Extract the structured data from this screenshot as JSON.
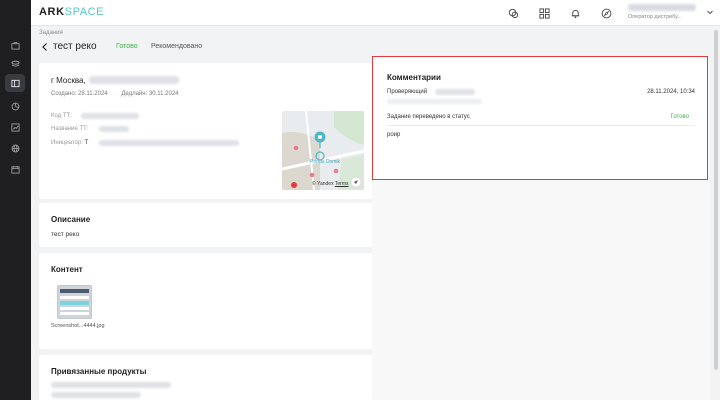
{
  "app": {
    "logo_main": "ARK",
    "logo_accent": "SPACE"
  },
  "user": {
    "role": "Оператор дистрибу..."
  },
  "breadcrumb": "Задания",
  "task": {
    "title": "тест реко",
    "status": "Готово",
    "recommended": "Рекомендовано"
  },
  "info": {
    "address": "г Москва,",
    "created": "Создано: 28.11.2024",
    "deadline": "Дедлайн: 30.11.2024",
    "field_code": "Код ТТ:",
    "field_name": "Название ТТ:",
    "field_initiator": "Инициатор:",
    "initiator_prefix": "Т",
    "map_place": "Portas Domik",
    "map_attribution": "© Yandex",
    "map_terms": "Terms"
  },
  "description": {
    "title": "Описание",
    "text": "тест реко"
  },
  "content": {
    "title": "Контент",
    "file_name": "Screenshot...4444.jpg"
  },
  "products": {
    "title": "Привязанные продукты"
  },
  "comments": {
    "title": "Комментарии",
    "author": "Проверяющий",
    "date": "28.11.2024, 10:34",
    "status_line": "Задание переведено в статус",
    "status_value": "Готово",
    "text": "роир"
  },
  "sidebar_icons": [
    "briefcase-icon",
    "layers-icon",
    "tasks-icon",
    "pie-icon",
    "chart-icon",
    "globe-icon",
    "calendar-icon"
  ],
  "colors": {
    "accent": "#59c7c0",
    "status_green": "#3bb54a",
    "highlight_red": "#e23b3b",
    "rail": "#1f1f22"
  }
}
